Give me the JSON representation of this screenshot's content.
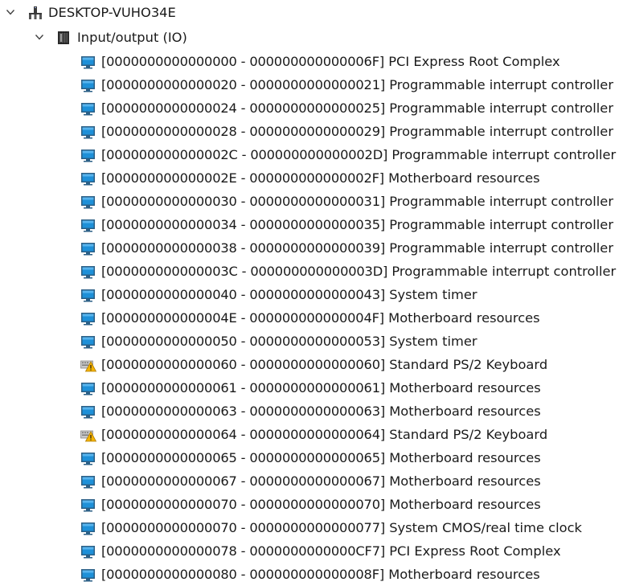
{
  "tree": {
    "root": {
      "label": "DESKTOP-VUHO34E",
      "icon": "computer-icon",
      "expanded": true
    },
    "category": {
      "label": "Input/output (IO)",
      "icon": "io-chip-icon",
      "expanded": true
    },
    "devices": [
      {
        "range": "[0000000000000000 - 000000000000006F]",
        "name": "PCI Express Root Complex",
        "icon": "monitor-device-icon"
      },
      {
        "range": "[0000000000000020 - 0000000000000021]",
        "name": "Programmable interrupt controller",
        "icon": "monitor-device-icon"
      },
      {
        "range": "[0000000000000024 - 0000000000000025]",
        "name": "Programmable interrupt controller",
        "icon": "monitor-device-icon"
      },
      {
        "range": "[0000000000000028 - 0000000000000029]",
        "name": "Programmable interrupt controller",
        "icon": "monitor-device-icon"
      },
      {
        "range": "[000000000000002C - 000000000000002D]",
        "name": "Programmable interrupt controller",
        "icon": "monitor-device-icon"
      },
      {
        "range": "[000000000000002E - 000000000000002F]",
        "name": "Motherboard resources",
        "icon": "monitor-device-icon"
      },
      {
        "range": "[0000000000000030 - 0000000000000031]",
        "name": "Programmable interrupt controller",
        "icon": "monitor-device-icon"
      },
      {
        "range": "[0000000000000034 - 0000000000000035]",
        "name": "Programmable interrupt controller",
        "icon": "monitor-device-icon"
      },
      {
        "range": "[0000000000000038 - 0000000000000039]",
        "name": "Programmable interrupt controller",
        "icon": "monitor-device-icon"
      },
      {
        "range": "[000000000000003C - 000000000000003D]",
        "name": "Programmable interrupt controller",
        "icon": "monitor-device-icon"
      },
      {
        "range": "[0000000000000040 - 0000000000000043]",
        "name": "System timer",
        "icon": "monitor-device-icon"
      },
      {
        "range": "[000000000000004E - 000000000000004F]",
        "name": "Motherboard resources",
        "icon": "monitor-device-icon"
      },
      {
        "range": "[0000000000000050 - 0000000000000053]",
        "name": "System timer",
        "icon": "monitor-device-icon"
      },
      {
        "range": "[0000000000000060 - 0000000000000060]",
        "name": "Standard PS/2 Keyboard",
        "icon": "keyboard-warning-icon"
      },
      {
        "range": "[0000000000000061 - 0000000000000061]",
        "name": "Motherboard resources",
        "icon": "monitor-device-icon"
      },
      {
        "range": "[0000000000000063 - 0000000000000063]",
        "name": "Motherboard resources",
        "icon": "monitor-device-icon"
      },
      {
        "range": "[0000000000000064 - 0000000000000064]",
        "name": "Standard PS/2 Keyboard",
        "icon": "keyboard-warning-icon"
      },
      {
        "range": "[0000000000000065 - 0000000000000065]",
        "name": "Motherboard resources",
        "icon": "monitor-device-icon"
      },
      {
        "range": "[0000000000000067 - 0000000000000067]",
        "name": "Motherboard resources",
        "icon": "monitor-device-icon"
      },
      {
        "range": "[0000000000000070 - 0000000000000070]",
        "name": "Motherboard resources",
        "icon": "monitor-device-icon"
      },
      {
        "range": "[0000000000000070 - 0000000000000077]",
        "name": "System CMOS/real time clock",
        "icon": "monitor-device-icon"
      },
      {
        "range": "[0000000000000078 - 0000000000000CF7]",
        "name": "PCI Express Root Complex",
        "icon": "monitor-device-icon"
      },
      {
        "range": "[0000000000000080 - 000000000000008F]",
        "name": "Motherboard resources",
        "icon": "monitor-device-icon"
      }
    ]
  },
  "colors": {
    "text": "#1a1a1a",
    "chevron": "#404040",
    "monitor_screen": "#1e90d8",
    "monitor_body": "#2b5f86",
    "warning": "#f5b400"
  }
}
